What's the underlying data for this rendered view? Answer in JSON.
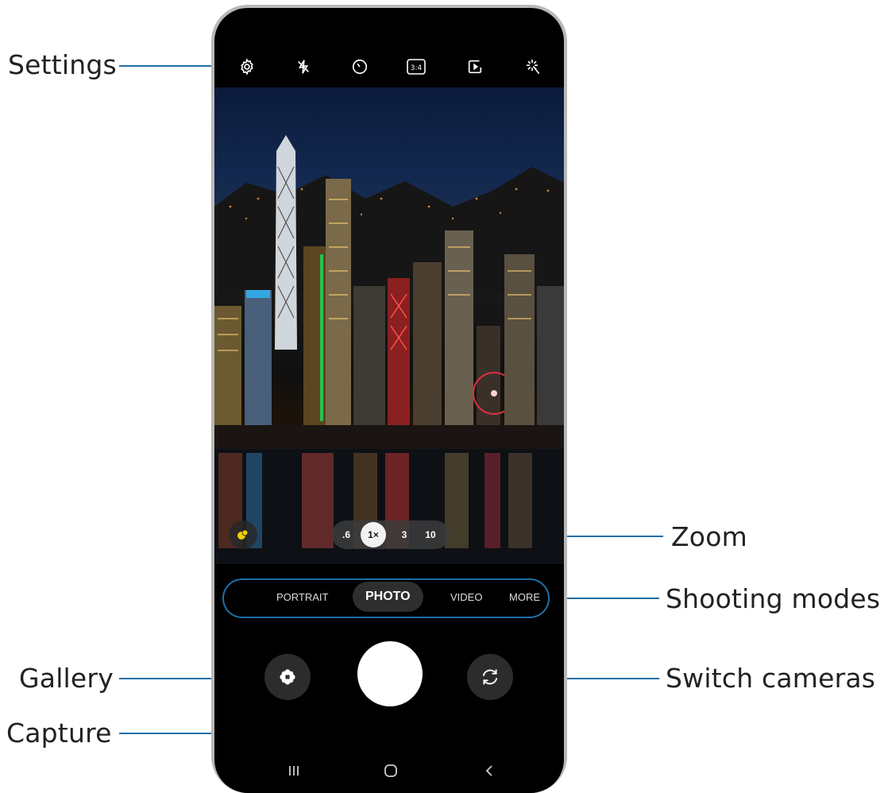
{
  "callouts": {
    "settings": "Settings",
    "zoom": "Zoom",
    "shooting_modes": "Shooting modes",
    "gallery": "Gallery",
    "switch_cameras": "Switch cameras",
    "capture": "Capture"
  },
  "top_bar": {
    "icons": [
      "settings-icon",
      "flash-off-icon",
      "timer-icon",
      "aspect-ratio-icon",
      "motion-photo-icon",
      "filters-icon"
    ],
    "aspect_ratio_text": "3:4"
  },
  "zoom": {
    "options": [
      ".6",
      "1×",
      "3",
      "10"
    ],
    "selected": "1×"
  },
  "modes": {
    "items": [
      "PORTRAIT",
      "PHOTO",
      "VIDEO",
      "MORE"
    ],
    "selected": "PHOTO"
  },
  "colors": {
    "callout_line": "#1f6fa8",
    "phone_frame": "#b8b8b8",
    "screen_bg": "#000000",
    "shutter": "#ffffff",
    "effects_dot": "#f5d000"
  }
}
